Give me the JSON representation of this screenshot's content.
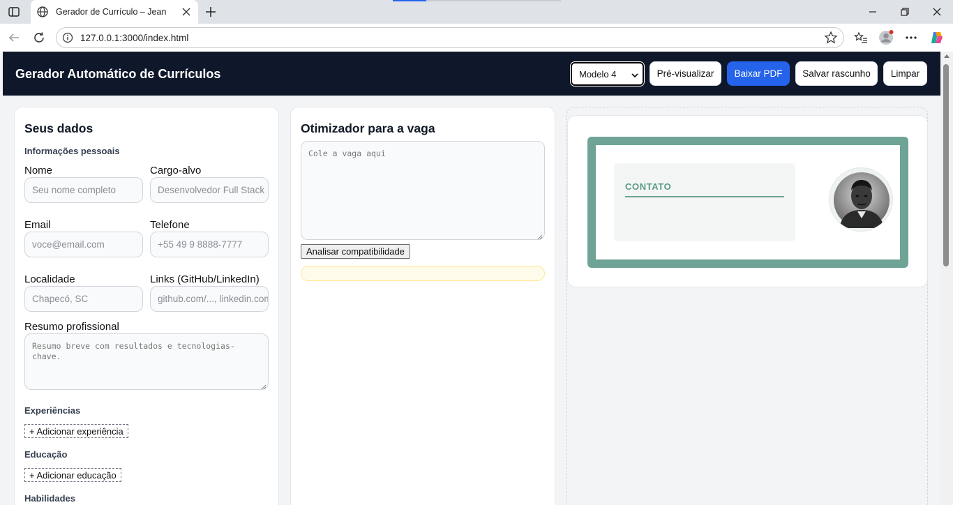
{
  "browser": {
    "tab_title": "Gerador de Currículo – Jean",
    "url": "127.0.0.1:3000/index.html"
  },
  "header": {
    "title": "Gerador Automático de Currículos",
    "model_select": "Modelo 4",
    "preview_button": "Pré-visualizar",
    "download_button": "Baixar PDF",
    "save_button": "Salvar rascunho",
    "clear_button": "Limpar"
  },
  "form": {
    "title": "Seus dados",
    "personal_section": "Informações pessoais",
    "fields": {
      "name_label": "Nome",
      "name_placeholder": "Seu nome completo",
      "role_label": "Cargo-alvo",
      "role_placeholder": "Desenvolvedor Full Stack",
      "email_label": "Email",
      "email_placeholder": "voce@email.com",
      "phone_label": "Telefone",
      "phone_placeholder": "+55 49 9 8888-7777",
      "location_label": "Localidade",
      "location_placeholder": "Chapecó, SC",
      "links_label": "Links (GitHub/LinkedIn)",
      "links_placeholder": "github.com/..., linkedin.com",
      "summary_label": "Resumo profissional",
      "summary_placeholder": "Resumo breve com resultados e tecnologias-chave."
    },
    "experience_section": "Experiências",
    "add_experience": "+ Adicionar experiência",
    "education_section": "Educação",
    "add_education": "+ Adicionar educação",
    "skills_section": "Habilidades"
  },
  "optimizer": {
    "title": "Otimizador para a vaga",
    "job_placeholder": "Cole a vaga aqui",
    "analyze_button": "Analisar compatibilidade"
  },
  "preview": {
    "contact_label": "CONTATO",
    "frame_color": "#6ea396"
  }
}
